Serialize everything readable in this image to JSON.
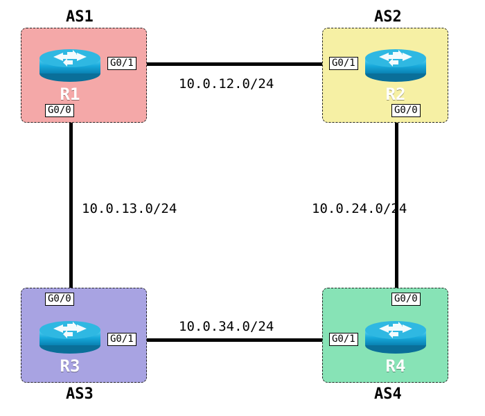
{
  "as": {
    "a1": {
      "label": "AS1"
    },
    "a2": {
      "label": "AS2"
    },
    "a3": {
      "label": "AS3"
    },
    "a4": {
      "label": "AS4"
    }
  },
  "routers": {
    "r1": {
      "name": "R1"
    },
    "r2": {
      "name": "R2"
    },
    "r3": {
      "name": "R3"
    },
    "r4": {
      "name": "R4"
    }
  },
  "interfaces": {
    "r1g00": "G0/0",
    "r1g01": "G0/1",
    "r2g00": "G0/0",
    "r2g01": "G0/1",
    "r3g00": "G0/0",
    "r3g01": "G0/1",
    "r4g00": "G0/0",
    "r4g01": "G0/1"
  },
  "nets": {
    "n12": "10.0.12.0/24",
    "n13": "10.0.13.0/24",
    "n24": "10.0.24.0/24",
    "n34": "10.0.34.0/24"
  },
  "colors": {
    "as1": "#f4a8a8",
    "as2": "#f6f0a4",
    "as3": "#a8a3e2",
    "as4": "#87e3b6",
    "router_gradient_top": "#3fbfe8",
    "router_gradient_bottom": "#0a84b8"
  }
}
